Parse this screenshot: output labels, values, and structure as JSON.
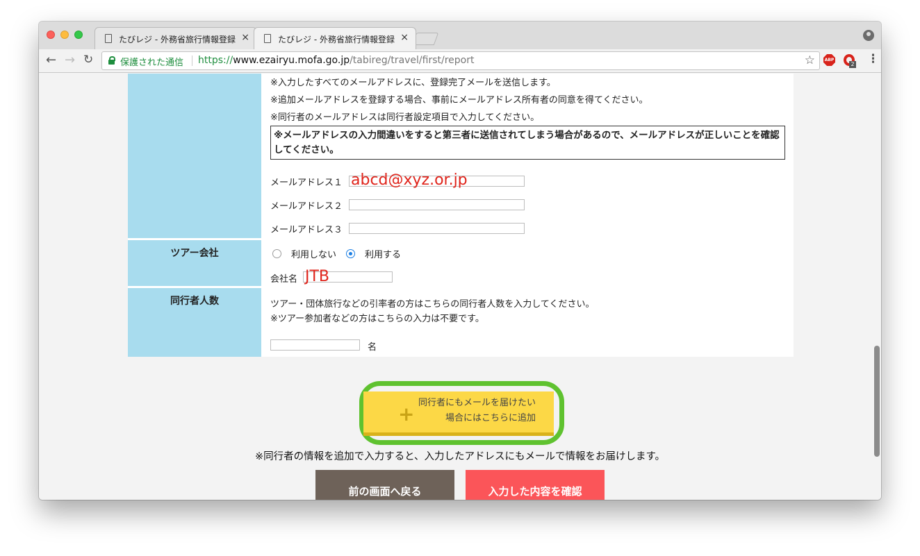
{
  "browser": {
    "tabs": [
      {
        "title": "たびレジ - 外務省旅行情報登録",
        "close": "×"
      },
      {
        "title": "たびレジ - 外務省旅行情報登録",
        "close": "×"
      }
    ],
    "security_label": "保護された通信",
    "url_scheme": "https://",
    "url_host": "www.ezairyu.mofa.go.jp",
    "url_path": "/tabireg/travel/first/report",
    "abp_label": "ABP",
    "ext_badge": "2"
  },
  "email_section": {
    "notes": [
      "※入力したすべてのメールアドレスに、登録完了メールを送信します。",
      "※追加メールアドレスを登録する場合、事前にメールアドレス所有者の同意を得てください。",
      "※同行者のメールアドレスは同行者設定項目で入力してください。"
    ],
    "warning": "※メールアドレスの入力間違いをすると第三者に送信されてしまう場合があるので、メールアドレスが正しいことを確認してください。",
    "fields": [
      {
        "label": "メールアドレス１",
        "value": "abcd@xyz.or.jp"
      },
      {
        "label": "メールアドレス２",
        "value": ""
      },
      {
        "label": "メールアドレス３",
        "value": ""
      }
    ]
  },
  "tour_section": {
    "label": "ツアー会社",
    "options": [
      "利用しない",
      "利用する"
    ],
    "selected": "利用する",
    "company_label": "会社名",
    "company_value": "JTB"
  },
  "companion_section": {
    "label": "同行者人数",
    "note1": "ツアー・団体旅行などの引率者の方はこちらの同行者人数を入力してください。",
    "note2": "※ツアー参加者などの方はこちらの入力は不要です。",
    "count_value": "",
    "unit": "名"
  },
  "add_button": {
    "line1": "同行者にもメールを届けたい",
    "line2": "場合にはこちらに追加",
    "plus": "+"
  },
  "bottom_note": "※同行者の情報を追加で入力すると、入力したアドレスにもメールで情報をお届けします。",
  "buttons": {
    "back": "前の画面へ戻る",
    "confirm": "入力した内容を確認"
  },
  "colors": {
    "label_bg": "#a8dcee",
    "add_button": "#fcd846",
    "highlight_frame": "#5fc22f",
    "back_button": "#6e6259",
    "confirm_button": "#fb5559",
    "handwriting": "#e0241b"
  }
}
